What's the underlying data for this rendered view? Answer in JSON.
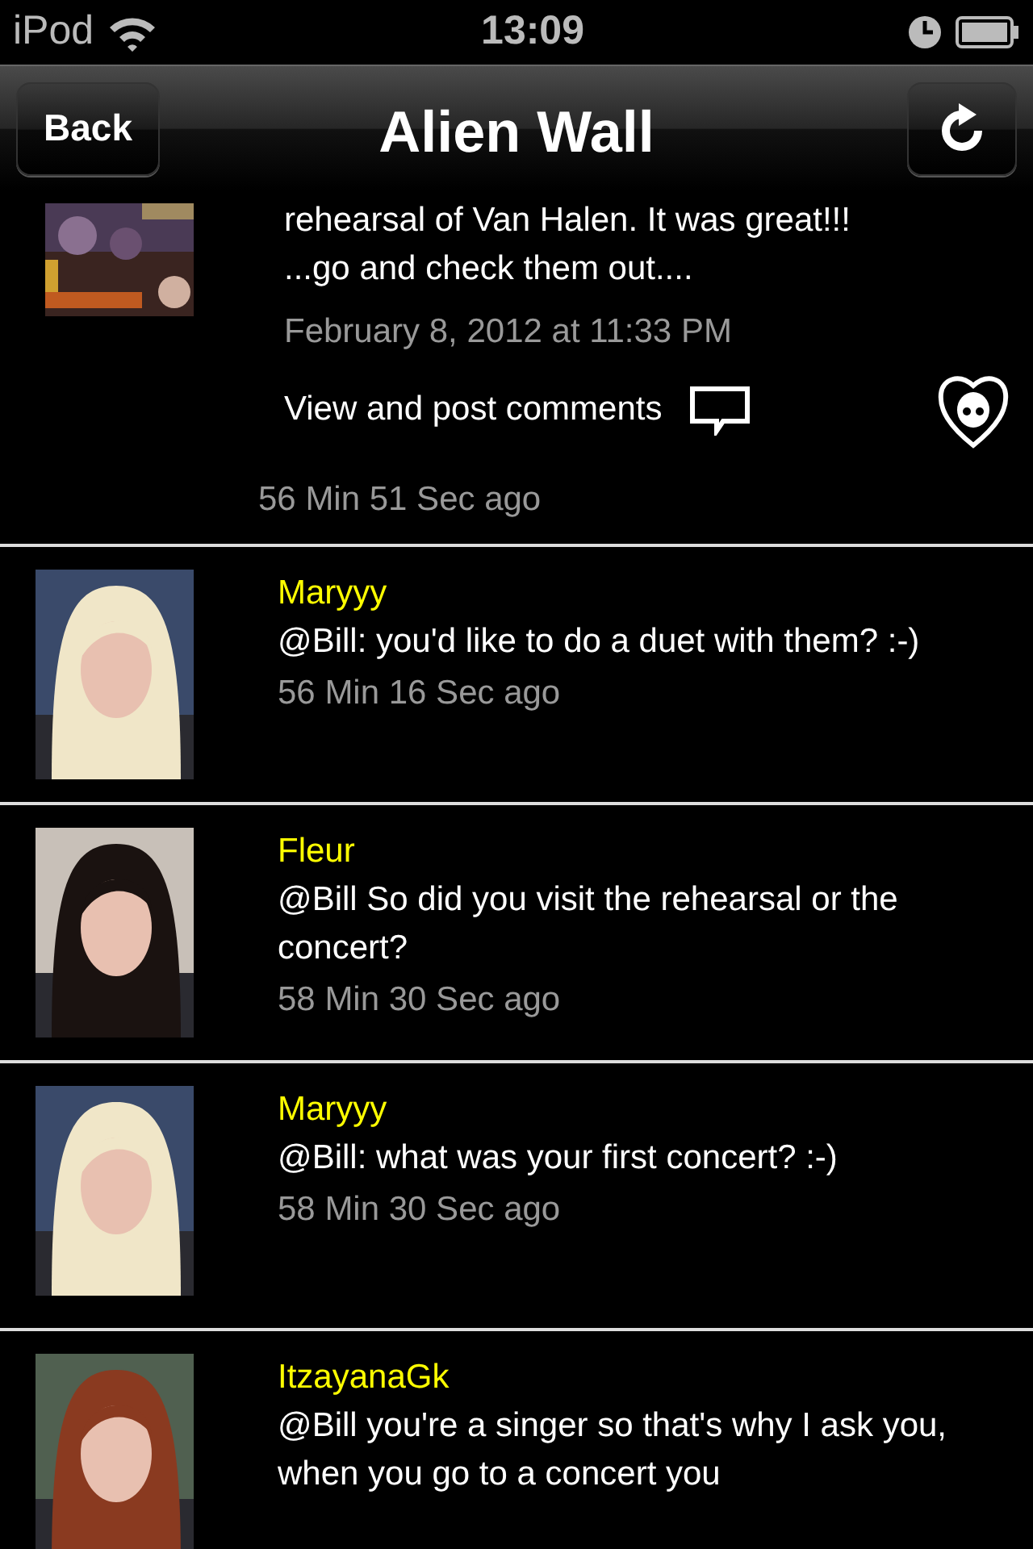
{
  "status_bar": {
    "carrier": "iPod",
    "time": "13:09"
  },
  "nav": {
    "back": "Back",
    "title": "Alien Wall"
  },
  "post": {
    "text_lines": [
      "rehearsal of Van Halen. It was great!!!",
      "...go and check them out...."
    ],
    "date": "February 8, 2012 at 11:33 PM",
    "comments_link": "View and post comments",
    "ago": "56 Min 51 Sec ago"
  },
  "comments": [
    {
      "author": "Maryyy",
      "text": "@Bill: you'd like to do a duet with them? :-)",
      "ago": "56 Min 16 Sec ago"
    },
    {
      "author": "Fleur",
      "text": "@Bill So did you visit the rehearsal or the concert?",
      "ago": "58 Min 30 Sec ago"
    },
    {
      "author": "Maryyy",
      "text": "@Bill: what was your first concert? :-)",
      "ago": "58 Min 30 Sec ago"
    },
    {
      "author": "ItzayanaGk",
      "text": "@Bill you're a singer so that's why I ask you, when you go to a concert you"
    }
  ]
}
